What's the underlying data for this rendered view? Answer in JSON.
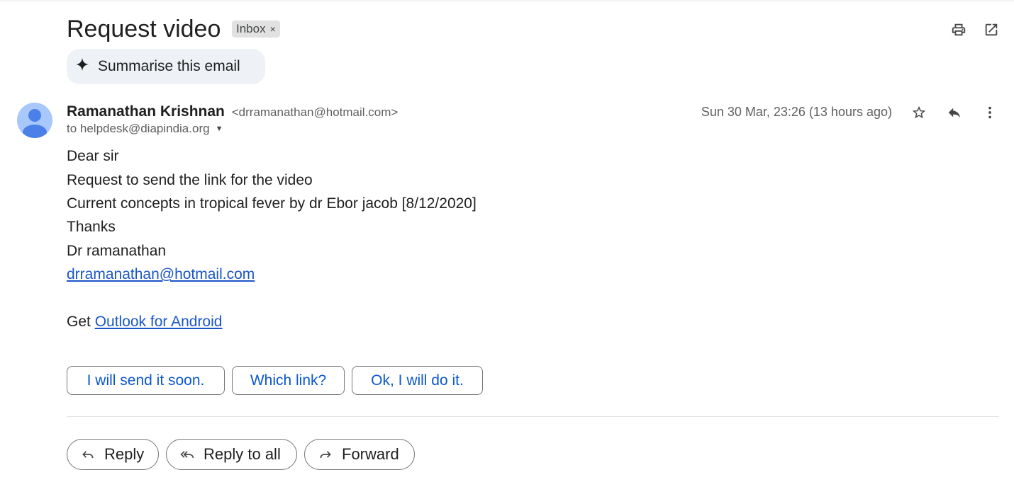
{
  "email": {
    "subject": "Request video",
    "label": "Inbox",
    "label_close": "×",
    "summarise_label": "Summarise this email",
    "sender_name": "Ramanathan Krishnan",
    "sender_email": "<drramanathan@hotmail.com>",
    "recipient": "to helpdesk@diapindia.org",
    "date": "Sun 30 Mar, 23:26 (13 hours ago)",
    "body": {
      "line1": "Dear sir",
      "line2": "Request to send the link  for the video",
      "line3": "Current concepts in tropical fever by  dr Ebor jacob [8/12/2020]",
      "line4": "Thanks",
      "line5": "Dr ramanathan",
      "email_link": "drramanathan@hotmail.com",
      "get_text": "Get ",
      "outlook_link": "Outlook for Android"
    }
  },
  "smart_replies": [
    "I will send it soon.",
    "Which link?",
    "Ok, I will do it."
  ],
  "actions": {
    "reply": "Reply",
    "reply_all": "Reply to all",
    "forward": "Forward"
  },
  "icons": {
    "print": "print-icon",
    "open_new_window": "open-in-new-window-icon",
    "star": "star-icon",
    "reply": "reply-icon",
    "more": "more-vert-icon",
    "sparkle": "sparkle-icon",
    "avatar": "person-avatar-icon"
  },
  "colors": {
    "link": "#1a56c8",
    "smart_reply_text": "#0b57d0",
    "avatar_bg": "#a8c7fa",
    "avatar_fg": "#4a80e8"
  }
}
